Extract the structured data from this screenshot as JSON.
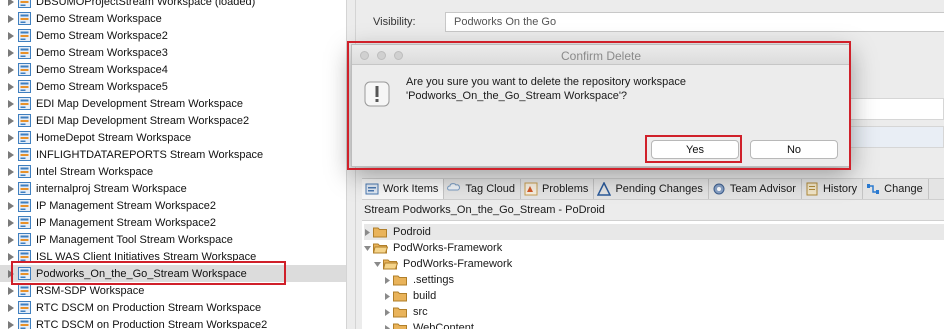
{
  "tree": {
    "items": [
      "DBSUMOProjectStream Workspace (loaded)",
      "Demo Stream Workspace",
      "Demo Stream Workspace2",
      "Demo Stream Workspace3",
      "Demo Stream Workspace4",
      "Demo Stream Workspace5",
      "EDI Map Development Stream Workspace",
      "EDI Map Development Stream Workspace2",
      "HomeDepot Stream Workspace",
      "INFLIGHTDATAREPORTS Stream Workspace",
      "Intel Stream Workspace",
      "internalproj Stream Workspace",
      "IP Management Stream Workspace2",
      "IP Management Stream Workspace2",
      "IP Management Tool Stream Workspace",
      "ISL WAS Client Initiatives Stream Workspace",
      "Podworks_On_the_Go_Stream Workspace",
      "RSM-SDP Workspace",
      "RTC DSCM on Production Stream Workspace",
      "RTC DSCM on Production Stream Workspace2"
    ],
    "selected_index": 16
  },
  "properties": {
    "visibility_label": "Visibility:",
    "visibility_value": "Podworks On the Go"
  },
  "dialog": {
    "title": "Confirm Delete",
    "message_line1": "Are you sure you want to delete the repository workspace",
    "message_line2": "'Podworks_On_the_Go_Stream Workspace'?",
    "yes_label": "Yes",
    "no_label": "No"
  },
  "tabs": [
    {
      "label": "Work Items",
      "icon": "work-items-icon"
    },
    {
      "label": "Tag Cloud",
      "icon": "tag-cloud-icon"
    },
    {
      "label": "Problems",
      "icon": "problems-icon"
    },
    {
      "label": "Pending Changes",
      "icon": "pending-changes-icon"
    },
    {
      "label": "Team Advisor",
      "icon": "team-advisor-icon"
    },
    {
      "label": "History",
      "icon": "history-icon"
    },
    {
      "label": "Change",
      "icon": "change-icon"
    }
  ],
  "stream_line": "Stream Podworks_On_the_Go_Stream - PoDroid",
  "content_tree": [
    {
      "label": "Podroid",
      "level": 0,
      "expanded": false
    },
    {
      "label": "PodWorks-Framework",
      "level": 0,
      "expanded": true
    },
    {
      "label": "PodWorks-Framework",
      "level": 1,
      "expanded": true
    },
    {
      "label": ".settings",
      "level": 2,
      "expanded": false
    },
    {
      "label": "build",
      "level": 2,
      "expanded": false
    },
    {
      "label": "src",
      "level": 2,
      "expanded": false
    },
    {
      "label": "WebContent",
      "level": 2,
      "expanded": false
    }
  ],
  "colors": {
    "highlight_red": "#d0202a",
    "workspace_icon_blue": "#3f7fbf",
    "workspace_icon_orange": "#e8912a",
    "folder_orange": "#e9b35a"
  }
}
